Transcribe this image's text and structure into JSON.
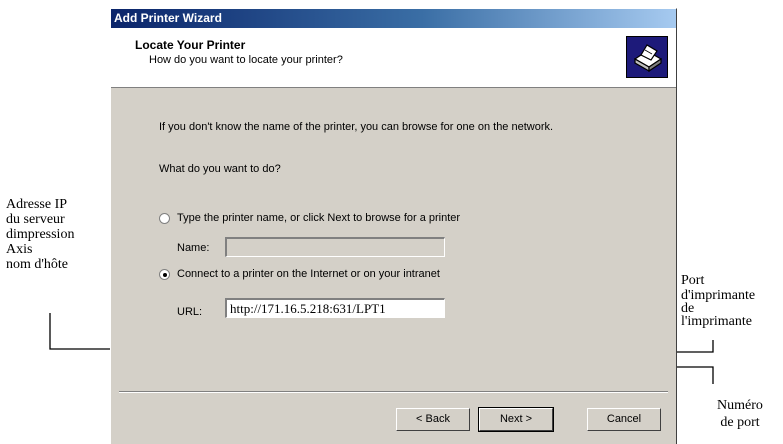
{
  "window": {
    "title": "Add Printer Wizard",
    "header_title": "Locate Your Printer",
    "header_subtitle": "How do you want to locate your printer?"
  },
  "body": {
    "intro": "If you don't know the name of the printer, you can browse for one on the network.",
    "question": "What do you want to do?"
  },
  "options": {
    "type_name": {
      "label": "Type the printer name, or click Next to browse for a printer",
      "selected": false,
      "field_label": "Name:",
      "field_value": ""
    },
    "connect_internet": {
      "label": "Connect to a printer on the Internet or on your intranet",
      "selected": true,
      "field_label": "URL:",
      "field_value": "http://171.16.5.218:631/LPT1"
    }
  },
  "buttons": {
    "back": "< Back",
    "next": "Next >",
    "cancel": "Cancel"
  },
  "annotations": {
    "left": [
      "Adresse IP",
      "du serveur",
      "dimpression",
      "Axis",
      "nom d'hôte"
    ],
    "port_name": [
      "Port",
      "d'imprimante",
      "de",
      "l'imprimante"
    ],
    "port_number": [
      "Numéro",
      "de port"
    ]
  },
  "colors": {
    "titlebar_start": "#0a246a",
    "titlebar_end": "#a6caf0",
    "dialog_bg": "#d4d0c8",
    "icon_bg": "#1d1a7a"
  },
  "icons": {
    "wizard_header": "printer-icon"
  }
}
